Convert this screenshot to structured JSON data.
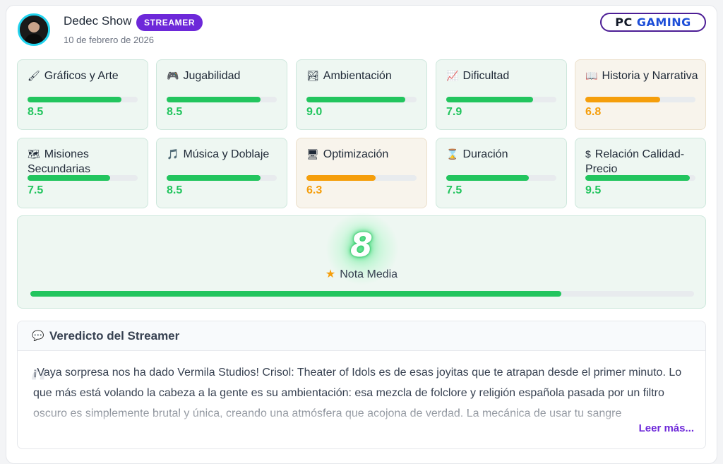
{
  "header": {
    "streamer_name": "Dedec Show",
    "badge": "STREAMER",
    "date": "10 de febrero de 2026",
    "logo_pc": "PC",
    "logo_gaming": "GAMING"
  },
  "scores": [
    {
      "icon": "🖌",
      "label": "Gráficos y Arte",
      "value": "8.5",
      "fill": 0.85
    },
    {
      "icon": "🎮",
      "label": "Jugabilidad",
      "value": "8.5",
      "fill": 0.85
    },
    {
      "icon": "🏞",
      "label": "Ambientación",
      "value": "9.0",
      "fill": 0.9
    },
    {
      "icon": "📈",
      "label": "Dificultad",
      "value": "7.9",
      "fill": 0.79
    },
    {
      "icon": "📖",
      "label": "Historia y Narrativa",
      "value": "6.8",
      "fill": 0.68
    },
    {
      "icon": "🗺",
      "label": "Misiones Secundarias",
      "value": "7.5",
      "fill": 0.75
    },
    {
      "icon": "🎵",
      "label": "Música y Doblaje",
      "value": "8.5",
      "fill": 0.85
    },
    {
      "icon": "🖥",
      "label": "Optimización",
      "value": "6.3",
      "fill": 0.63
    },
    {
      "icon": "⌛",
      "label": "Duración",
      "value": "7.5",
      "fill": 0.75
    },
    {
      "icon": "$",
      "label": "Relación Calidad-Precio",
      "value": "9.5",
      "fill": 0.95
    }
  ],
  "average": {
    "value": "8",
    "label": "Nota Media",
    "fill": 0.8
  },
  "verdict": {
    "title": "Veredicto del Streamer",
    "text": "¡Vaya sorpresa nos ha dado Vermila Studios! Crisol: Theater of Idols es de esas joyitas que te atrapan desde el primer minuto. Lo que más está volando la cabeza a la gente es su ambientación: esa mezcla de folclore y religión española pasada por un filtro oscuro es simplemente brutal y única, creando una atmósfera que acojona de verdad. La mecánica de usar tu sangre",
    "read_more": "Leer más..."
  },
  "colors": {
    "good": "#22c55e",
    "warn": "#f59e0b",
    "accent": "#6d28d9",
    "avatar_ring": "#22d3ee"
  }
}
